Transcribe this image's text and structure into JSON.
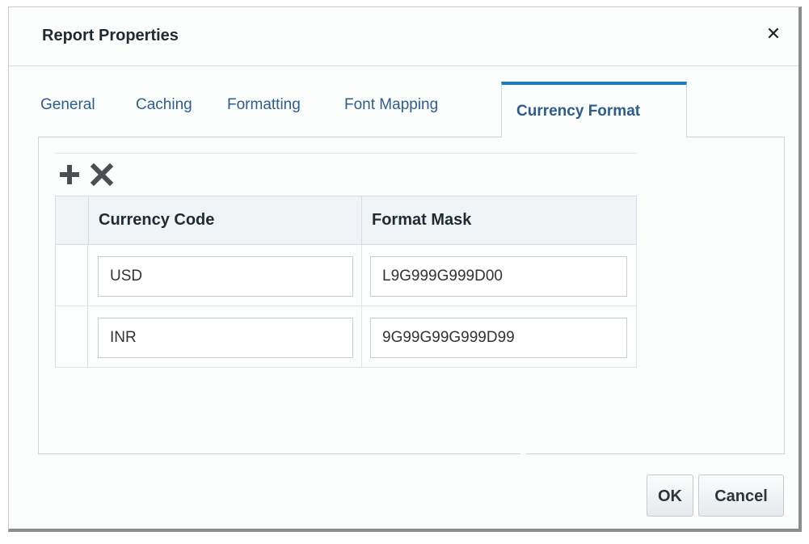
{
  "dialog": {
    "title": "Report Properties",
    "close_icon": "close-icon"
  },
  "tabs": [
    {
      "label": "General",
      "active": false
    },
    {
      "label": "Caching",
      "active": false
    },
    {
      "label": "Formatting",
      "active": false
    },
    {
      "label": "Font Mapping",
      "active": false
    },
    {
      "label": "Currency Format",
      "active": true
    }
  ],
  "toolbar": {
    "add_icon": "plus-icon",
    "delete_icon": "delete-x-icon"
  },
  "grid": {
    "columns": [
      "Currency Code",
      "Format Mask"
    ],
    "rows": [
      {
        "currency_code": "USD",
        "format_mask": "L9G999G999D00"
      },
      {
        "currency_code": "INR",
        "format_mask": "9G99G99G999D99"
      }
    ]
  },
  "footer": {
    "ok_label": "OK",
    "cancel_label": "Cancel"
  },
  "colors": {
    "accent": "#1a7bc4",
    "tab_text": "#2d5d8e",
    "header_bg": "#f0f4f7"
  }
}
